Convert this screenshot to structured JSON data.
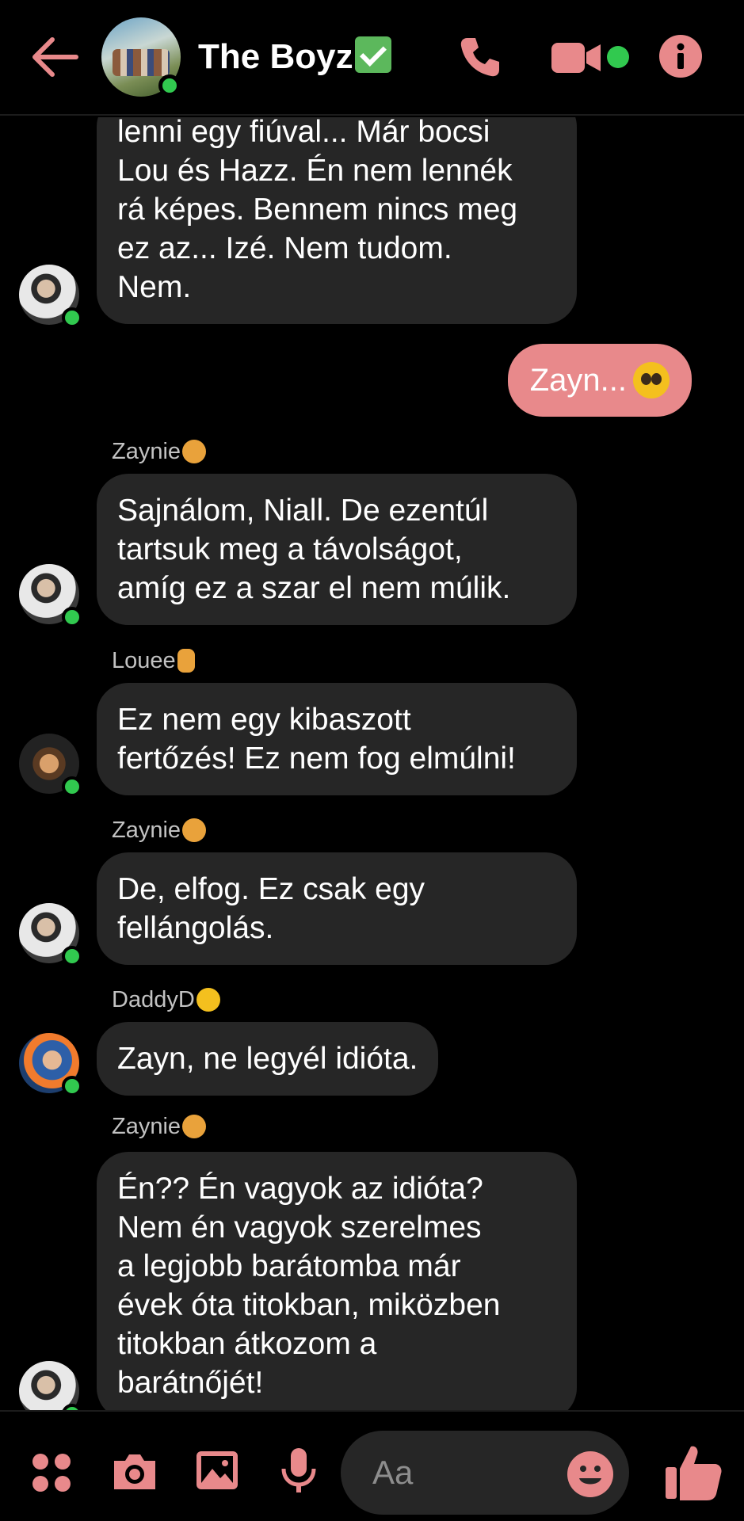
{
  "header": {
    "title": "The Boyz",
    "icons": [
      "back-arrow-icon",
      "phone-icon",
      "video-camera-icon",
      "info-icon",
      "verified-check-icon"
    ],
    "accent_color": "#e8898b",
    "online_color": "#31c94f"
  },
  "messages": [
    {
      "type": "received",
      "sender": "",
      "avatar": "zayn",
      "lines": [
        "lenni egy fiúval... Már bocsi",
        "Lou és Hazz. Én nem lennék",
        "rá képes. Bennem nincs meg",
        "ez az... Izé. Nem tudom.",
        "Nem."
      ]
    },
    {
      "type": "sent",
      "text": "Zayn...",
      "emoji": "pleading-face-emoji"
    },
    {
      "type": "received",
      "sender": "Zaynie",
      "sender_emoji": "ok-hand-emoji",
      "avatar": "zayn",
      "lines": [
        "Sajnálom, Niall. De ezentúl",
        "tartsuk meg a távolságot,",
        "amíg ez a szar el nem múlik."
      ]
    },
    {
      "type": "received",
      "sender": "Louee",
      "sender_emoji": "middle-finger-emoji",
      "avatar": "louis",
      "lines": [
        "Ez nem egy kibaszott",
        "fertőzés! Ez nem fog elmúlni!"
      ]
    },
    {
      "type": "received",
      "sender": "Zaynie",
      "sender_emoji": "ok-hand-emoji",
      "avatar": "zayn",
      "lines": [
        "De, elfog. Ez csak egy",
        "fellángolás."
      ]
    },
    {
      "type": "received",
      "sender": "DaddyD",
      "sender_emoji": "smirk-emoji",
      "avatar": "liam",
      "lines": [
        "Zayn, ne legyél idióta."
      ]
    },
    {
      "type": "received",
      "sender": "Zaynie",
      "sender_emoji": "ok-hand-emoji",
      "avatar": "zayn",
      "lines": [
        "Én?? Én vagyok az idióta?",
        "Nem én vagyok szerelmes",
        "a legjobb barátomba már",
        "évek óta titokban, miközben",
        "titokban átkozom a",
        "barátnőjét!"
      ]
    }
  ],
  "composer": {
    "placeholder": "Aa",
    "icons": [
      "menu-dots-icon",
      "camera-icon",
      "gallery-icon",
      "microphone-icon",
      "emoji-icon",
      "like-thumb-icon"
    ]
  }
}
